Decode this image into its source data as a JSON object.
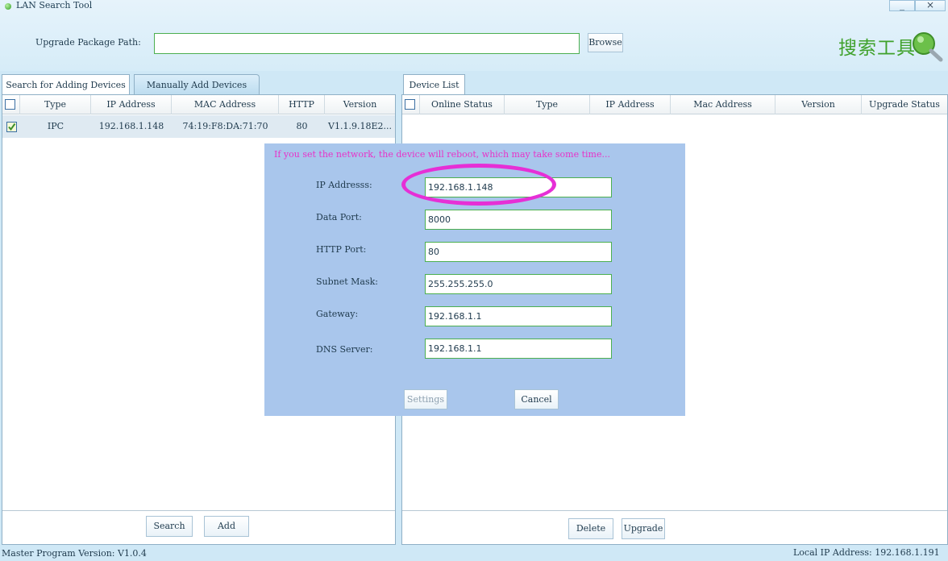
{
  "window": {
    "title": "LAN Search Tool",
    "minimize_glyph": "_",
    "close_glyph": "×"
  },
  "toolbar": {
    "upgrade_path_label": "Upgrade Package Path:",
    "upgrade_path_value": "",
    "browse_label": "Browse",
    "logo_text": "搜索工具",
    "logo_icon": "magnifier-globe-icon"
  },
  "left_panel": {
    "tabs": [
      {
        "label": "Search for Adding Devices",
        "active": true
      },
      {
        "label": "Manually Add Devices",
        "active": false
      }
    ],
    "columns": [
      "Type",
      "IP Address",
      "MAC Address",
      "HTTP Port",
      "Version"
    ],
    "rows": [
      {
        "checked": true,
        "type": "IPC",
        "ip": "192.168.1.148",
        "mac": "74:19:F8:DA:71:70",
        "http_port": "80",
        "version": "V1.1.9.18E2..."
      }
    ],
    "search_label": "Search",
    "add_label": "Add"
  },
  "right_panel": {
    "tab_label": "Device List",
    "columns": [
      "Online Status",
      "Type",
      "IP Address",
      "Mac Address",
      "Version",
      "Upgrade Status"
    ],
    "delete_label": "Delete",
    "upgrade_label": "Upgrade"
  },
  "dialog": {
    "warning": "If you set the network, the device will reboot, which may take some time...",
    "fields": [
      {
        "label": "IP Addresss:",
        "value": "192.168.1.148"
      },
      {
        "label": "Data Port:",
        "value": "8000"
      },
      {
        "label": "HTTP Port:",
        "value": "80"
      },
      {
        "label": "Subnet Mask:",
        "value": "255.255.255.0"
      },
      {
        "label": "Gateway:",
        "value": "192.168.1.1"
      },
      {
        "label": "DNS Server:",
        "value": "192.168.1.1"
      }
    ],
    "settings_label": "Settings",
    "cancel_label": "Cancel"
  },
  "status_bar": {
    "master_version": "Master Program Version: V1.0.4",
    "local_ip": "Local IP Address: 192.168.1.191"
  },
  "colors": {
    "accent_green": "#3fa12b",
    "highlight_magenta": "#e62fd6",
    "dialog_bg": "#a9c6ec"
  }
}
